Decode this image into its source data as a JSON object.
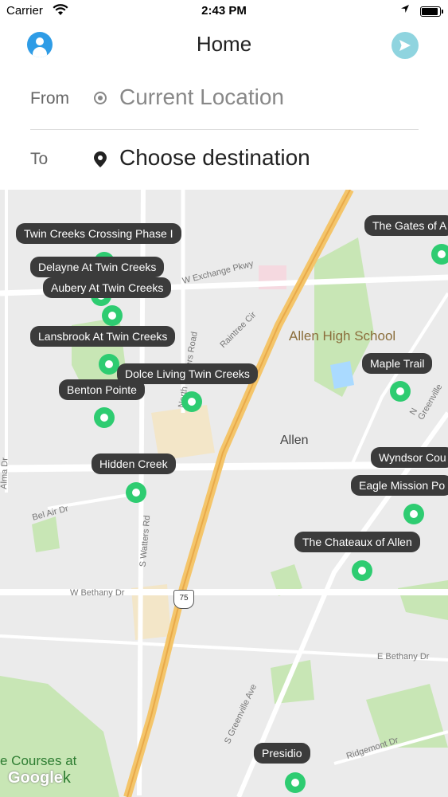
{
  "status_bar": {
    "carrier": "Carrier",
    "time": "2:43 PM",
    "battery_level": 0.9
  },
  "header": {
    "title": "Home"
  },
  "from_field": {
    "label": "From",
    "value": "Current Location"
  },
  "to_field": {
    "label": "To",
    "value": "Choose destination"
  },
  "map": {
    "places": {
      "allen_high_school": "Allen High School",
      "allen": "Allen",
      "courses": "e Courses at",
      "google": "Google",
      "google_suffix": "k"
    },
    "streets": {
      "w_exchange_pkwy": "W Exchange Pkwy",
      "raintree_cir": "Raintree Cir",
      "north_watters_road": "North Watters Road",
      "alma_dr": "Alma Dr",
      "bel_air_dr": "Bel Air Dr",
      "s_watters_rd": "S Watters Rd",
      "w_bethany_dr": "W Bethany Dr",
      "e_bethany_dr": "E Bethany Dr",
      "s_greenville_ave": "S Greenville Ave",
      "ridgemont_dr": "Ridgemont Dr",
      "n_greenville": "N Greenville",
      "us_75": "75"
    },
    "communities": [
      {
        "label": "Twin Creeks Crossing Phase I"
      },
      {
        "label": "Delayne At Twin Creeks"
      },
      {
        "label": "Aubery At Twin Creeks"
      },
      {
        "label": "Lansbrook At Twin Creeks"
      },
      {
        "label": "Dolce Living Twin Creeks"
      },
      {
        "label": "Benton Pointe"
      },
      {
        "label": "Hidden Creek"
      },
      {
        "label": "The Gates of A"
      },
      {
        "label": "Maple Trail"
      },
      {
        "label": "Wyndsor Cou"
      },
      {
        "label": "Eagle Mission Po"
      },
      {
        "label": "The Chateaux of Allen"
      },
      {
        "label": "Presidio"
      }
    ]
  },
  "colors": {
    "marker": "#2ecc71",
    "highway": "#f4c56a",
    "tooltip": "#3b3b3b",
    "avatar": "#2e9ce6",
    "send": "#8fd4df"
  }
}
